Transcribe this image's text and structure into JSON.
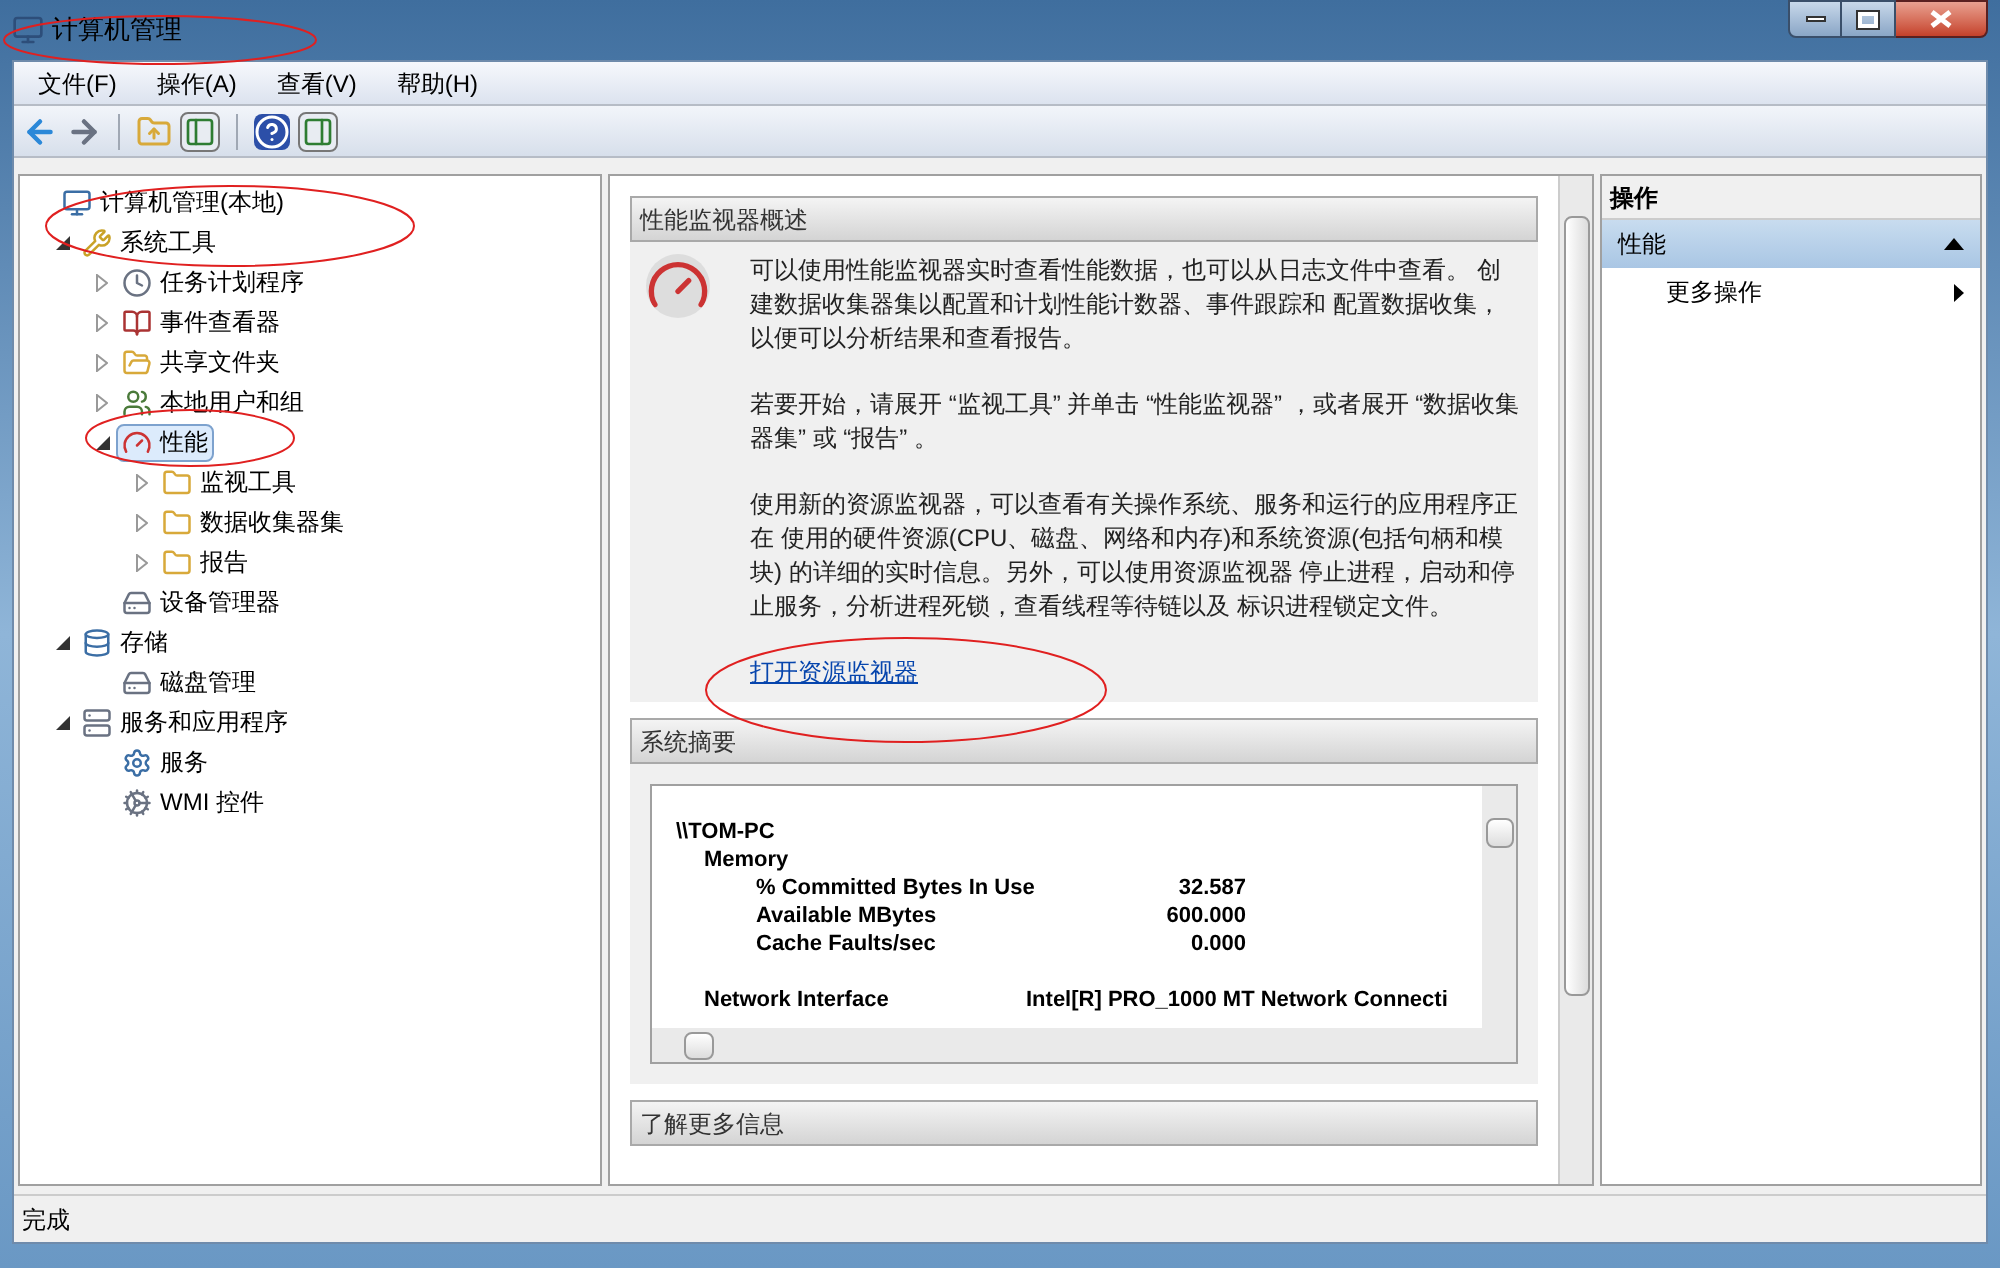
{
  "window": {
    "title": "计算机管理"
  },
  "menu": [
    "文件(F)",
    "操作(A)",
    "查看(V)",
    "帮助(H)"
  ],
  "tree": [
    {
      "label": "计算机管理(本地)",
      "selected": false,
      "children": [
        {
          "label": "系统工具",
          "selected": false,
          "expanded": true,
          "children": [
            {
              "label": "任务计划程序",
              "selected": false,
              "expanded": false
            },
            {
              "label": "事件查看器",
              "selected": false,
              "expanded": false
            },
            {
              "label": "共享文件夹",
              "selected": false,
              "expanded": false
            },
            {
              "label": "本地用户和组",
              "selected": false,
              "expanded": false
            },
            {
              "label": "性能",
              "selected": true,
              "expanded": true,
              "children": [
                {
                  "label": "监视工具",
                  "selected": false,
                  "expanded": false
                },
                {
                  "label": "数据收集器集",
                  "selected": false,
                  "expanded": false
                },
                {
                  "label": "报告",
                  "selected": false,
                  "expanded": false
                }
              ]
            },
            {
              "label": "设备管理器",
              "selected": false
            }
          ]
        },
        {
          "label": "存储",
          "selected": false,
          "expanded": true,
          "children": [
            {
              "label": "磁盘管理",
              "selected": false
            }
          ]
        },
        {
          "label": "服务和应用程序",
          "selected": false,
          "expanded": true,
          "children": [
            {
              "label": "服务",
              "selected": false
            },
            {
              "label": "WMI 控件",
              "selected": false
            }
          ]
        }
      ]
    }
  ],
  "overview": {
    "title": "性能监视器概述",
    "paragraphs": [
      "可以使用性能监视器实时查看性能数据，也可以从日志文件中查看。 创建数据收集器集以配置和计划性能计数器、事件跟踪和 配置数据收集，以便可以分析结果和查看报告。",
      "若要开始，请展开 “监视工具” 并单击 “性能监视器” ，或者展开 “数据收集器集” 或 “报告” 。",
      "使用新的资源监视器，可以查看有关操作系统、服务和运行的应用程序正在 使用的硬件资源(CPU、磁盘、网络和内存)和系统资源(包括句柄和模块) 的详细的实时信息。另外，可以使用资源监视器 停止进程，启动和停止服务，分析进程死锁，查看线程等待链以及 标识进程锁定文件。"
    ],
    "link": "打开资源监视器"
  },
  "summary": {
    "title": "系统摘要",
    "rows": [
      {
        "kind": "machine",
        "name": "\\\\TOM-PC"
      },
      {
        "kind": "object",
        "name": "Memory"
      },
      {
        "kind": "counter",
        "name": "% Committed Bytes In Use",
        "value": "32.587"
      },
      {
        "kind": "counter",
        "name": "Available MBytes",
        "value": "600.000"
      },
      {
        "kind": "counter",
        "name": "Cache Faults/sec",
        "value": "0.000"
      },
      {
        "kind": "gap"
      },
      {
        "kind": "object",
        "name": "Network Interface",
        "value": "Intel[R] PRO_1000 MT Network Connecti"
      }
    ]
  },
  "more_info": {
    "title": "了解更多信息"
  },
  "actions": {
    "title": "操作",
    "group": {
      "label": "性能",
      "expanded": true
    },
    "items": [
      "更多操作"
    ]
  },
  "status_bar": "完成"
}
